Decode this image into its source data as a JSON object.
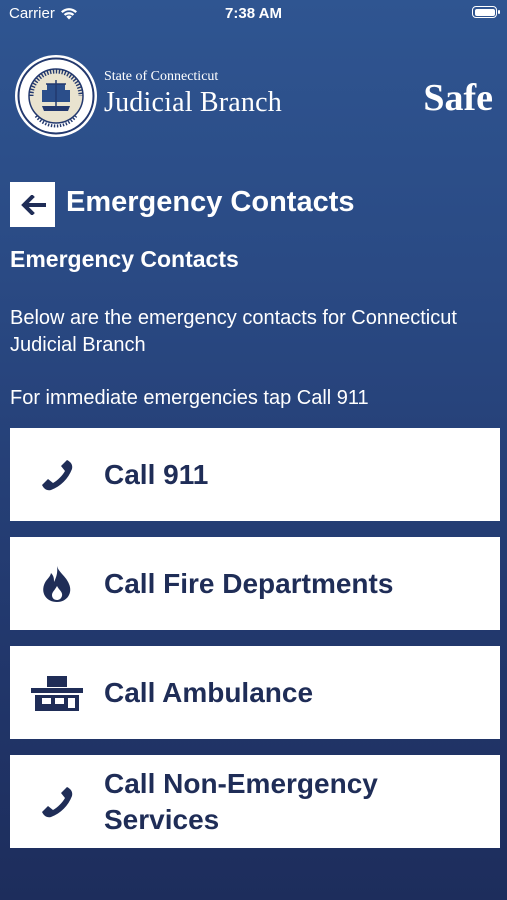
{
  "status_bar": {
    "carrier": "Carrier",
    "time": "7:38 AM"
  },
  "header": {
    "brand_top": "State of Connecticut",
    "brand_main": "Judicial Branch",
    "brand_right": "Safe"
  },
  "page": {
    "title": "Emergency Contacts",
    "section_title": "Emergency Contacts",
    "description": "Below are the emergency contacts for Connecticut Judicial Branch",
    "instruction": "For immediate emergencies tap Call 911"
  },
  "contacts": [
    {
      "label": "Call 911",
      "icon": "phone-icon"
    },
    {
      "label": "Call Fire Departments",
      "icon": "fire-icon"
    },
    {
      "label": "Call Ambulance",
      "icon": "ambulance-icon"
    },
    {
      "label": "Call Non-Emergency Services",
      "icon": "phone-icon"
    }
  ],
  "colors": {
    "background": "#2a4a84",
    "card": "#ffffff",
    "card_text": "#1f2d57"
  }
}
